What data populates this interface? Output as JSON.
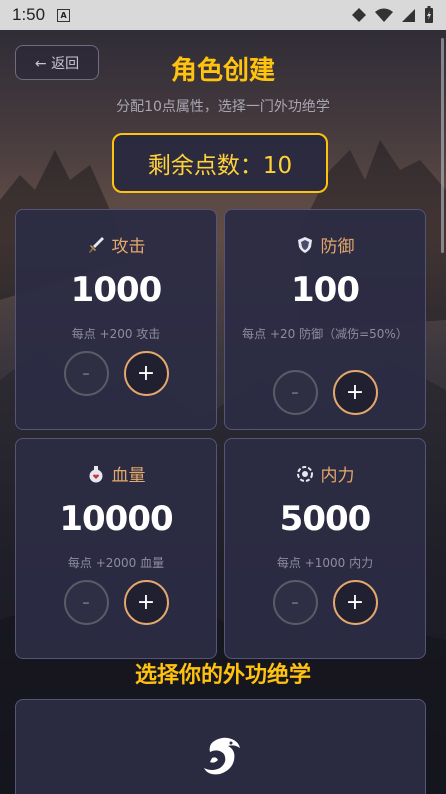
{
  "status_bar": {
    "time": "1:50",
    "notification_letter": "A"
  },
  "header": {
    "back_label": "← 返回",
    "title": "角色创建",
    "subtitle": "分配10点属性，选择一门外功绝学"
  },
  "points": {
    "label": "剩余点数：10",
    "remaining": 10
  },
  "attributes": [
    {
      "name": "攻击",
      "icon": "sword-icon",
      "value": "1000",
      "desc": "每点 +200 攻击",
      "minus": "-",
      "plus": "+"
    },
    {
      "name": "防御",
      "icon": "shield-icon",
      "value": "100",
      "desc": "每点 +20 防御（减伤=50%）",
      "minus": "-",
      "plus": "+"
    },
    {
      "name": "血量",
      "icon": "health-potion-icon",
      "value": "10000",
      "desc": "每点 +2000 血量",
      "minus": "-",
      "plus": "+"
    },
    {
      "name": "内力",
      "icon": "energy-icon",
      "value": "5000",
      "desc": "每点 +1000 内力",
      "minus": "-",
      "plus": "+"
    }
  ],
  "skills": {
    "section_title": "选择你的外功绝学",
    "first_skill_icon": "dragon-icon"
  },
  "colors": {
    "accent": "#ffc20e",
    "attr_label": "#e4a86c",
    "card_bg": "#2c2c44"
  }
}
